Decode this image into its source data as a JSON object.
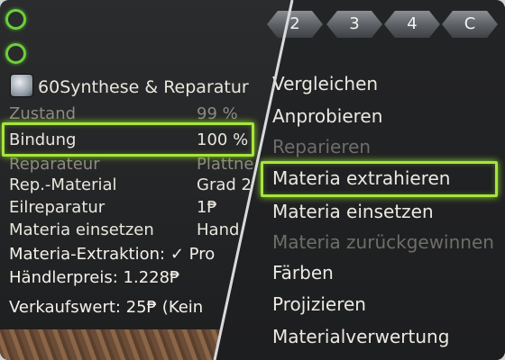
{
  "item_panel": {
    "header": {
      "level": "60",
      "title": "Synthese & Reparatur"
    },
    "stats": [
      {
        "label": "Zustand",
        "value": "99 %"
      },
      {
        "label": "Bindung",
        "value": "100 %"
      },
      {
        "label": "Reparateur",
        "value": "Plattne"
      },
      {
        "label": "Rep.-Material",
        "value": "Grad 2"
      },
      {
        "label": "Eilreparatur",
        "value": "1₱"
      },
      {
        "label": "Materia einsetzen",
        "value": "Hand"
      }
    ],
    "extraction": {
      "label": "Materia-Extraktion:",
      "check": "✓",
      "value": "Pro"
    },
    "merchant_price": "Händlerpreis: 1.228₱",
    "sell_value": "Verkaufswert: 25₱",
    "sell_note": "(Kein"
  },
  "tabs": [
    "2",
    "3",
    "4",
    "C"
  ],
  "context_menu": {
    "items": [
      {
        "label": "Vergleichen",
        "enabled": true
      },
      {
        "label": "Anprobieren",
        "enabled": true
      },
      {
        "label": "Reparieren",
        "enabled": false
      },
      {
        "label": "Materia extrahieren",
        "enabled": true,
        "highlighted": true
      },
      {
        "label": "Materia einsetzen",
        "enabled": true
      },
      {
        "label": "Materia zurückgewinnen",
        "enabled": false
      },
      {
        "label": "Färben",
        "enabled": true
      },
      {
        "label": "Projizieren",
        "enabled": true
      },
      {
        "label": "Materialverwertung",
        "enabled": true
      }
    ]
  },
  "colors": {
    "highlight": "#a6e63c",
    "text": "#e9e6de",
    "disabled": "#6f6d68"
  },
  "icons": [
    "green-ring-icon",
    "crafting-class-icon",
    "checkmark-icon"
  ]
}
